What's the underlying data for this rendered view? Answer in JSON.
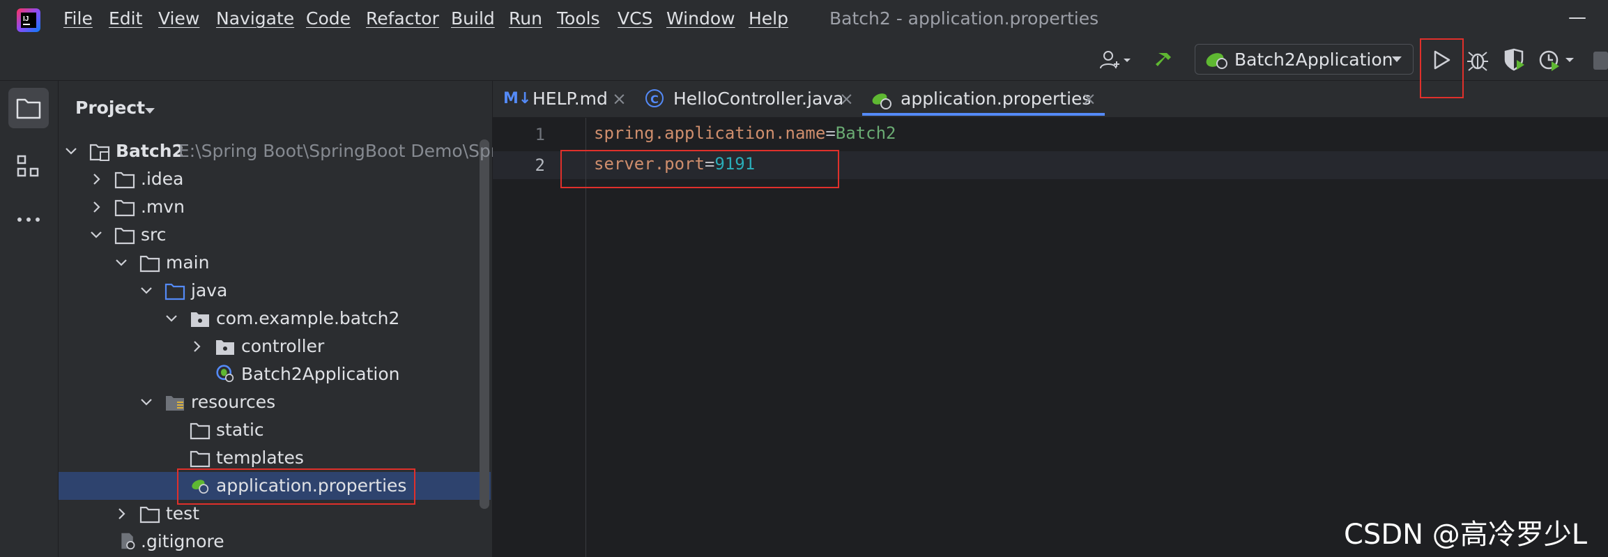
{
  "menu": {
    "items": [
      "File",
      "Edit",
      "View",
      "Navigate",
      "Code",
      "Refactor",
      "Build",
      "Run",
      "Tools",
      "VCS",
      "Window",
      "Help"
    ]
  },
  "window": {
    "title": "Batch2 - application.properties",
    "minimize": "—"
  },
  "toolbar": {
    "run_config": "Batch2Application"
  },
  "project": {
    "title": "Project",
    "root_name": "Batch2",
    "root_path": "E:\\Spring Boot\\SpringBoot Demo\\Sprin",
    "nodes": {
      "idea": ".idea",
      "mvn": ".mvn",
      "src": "src",
      "main": "main",
      "java": "java",
      "package": "com.example.batch2",
      "controller": "controller",
      "app": "Batch2Application",
      "resources": "resources",
      "static": "static",
      "templates": "templates",
      "props": "application.properties",
      "test": "test",
      "gitignore": ".gitignore"
    }
  },
  "tabs": {
    "help_icon": "M↓",
    "help": "HELP.md",
    "controller_icon": "C",
    "controller": "HelloController.java",
    "props": "application.properties",
    "close": "×"
  },
  "editor": {
    "line1_num": "1",
    "line2_num": "2",
    "line1_key": "spring.application.name",
    "line1_eq": "=",
    "line1_value": "Batch2",
    "line2_key": "server.port",
    "line2_eq": "=",
    "line2_value": "9191"
  },
  "watermark": "CSDN @高冷罗少L",
  "colors": {
    "selection": "#2e436e",
    "accent": "#548af7",
    "highlight_box": "#e0302b",
    "spring_green": "#5fb832"
  }
}
